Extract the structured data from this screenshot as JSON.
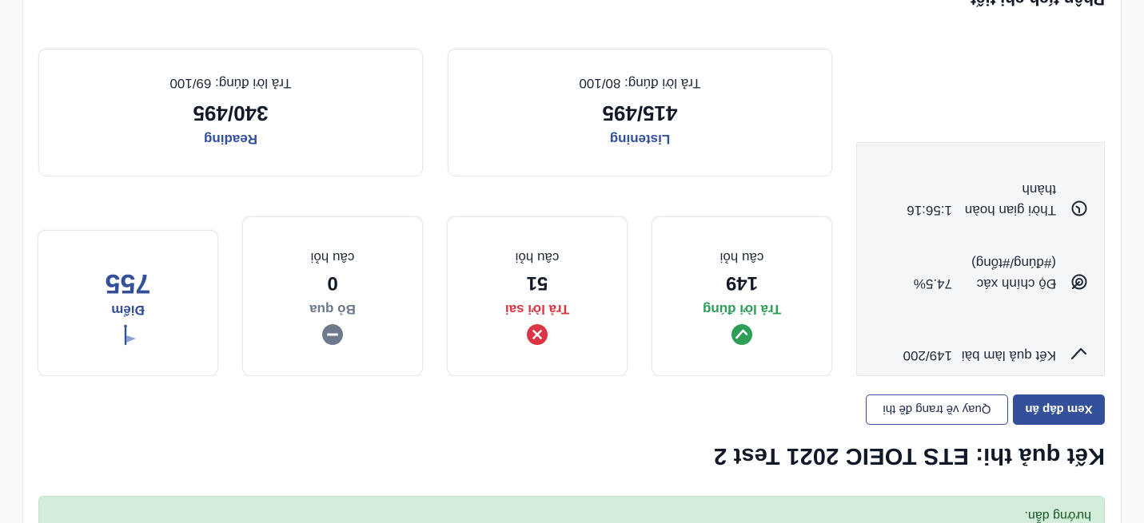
{
  "alert": {
    "text": "hướng dẫn."
  },
  "page": {
    "title": "Kết quả thi: ETS TOEIC 2021 Test 2"
  },
  "buttons": {
    "view_answers": "Xem đáp án",
    "back_to_test": "Quay về trang đề thi"
  },
  "summary": {
    "result_label": "Kết quả làm bài",
    "result_value": "149/200",
    "accuracy_label": "Độ chính xác (#đúng/#tổng)",
    "accuracy_value": "74.5%",
    "time_label": "Thời gian hoàn thành",
    "time_value": "1:56:16"
  },
  "stats": {
    "correct": {
      "label": "Trả lời đúng",
      "value": "149",
      "unit": "câu hỏi"
    },
    "wrong": {
      "label": "Trả lời sai",
      "value": "51",
      "unit": "câu hỏi"
    },
    "skipped": {
      "label": "Bỏ qua",
      "value": "0",
      "unit": "câu hỏi"
    },
    "score": {
      "label": "Điểm",
      "value": "755"
    }
  },
  "parts": {
    "listening": {
      "name": "Listening",
      "score": "415/495",
      "correct": "Trả lời đúng: 80/100"
    },
    "reading": {
      "name": "Reading",
      "score": "340/495",
      "correct": "Trả lời đúng: 69/100"
    }
  },
  "section": {
    "title": "Phân tích chi tiết"
  },
  "colors": {
    "primary": "#35509a",
    "success": "#2e9e57",
    "danger": "#dc3545",
    "muted": "#6c7a8c",
    "alert_bg": "#d4edda"
  },
  "icons": {
    "result": "check-icon",
    "accuracy": "target-icon",
    "time": "clock-icon",
    "correct": "check-circle-icon",
    "wrong": "x-circle-icon",
    "skipped": "minus-circle-icon",
    "score": "flag-icon"
  }
}
